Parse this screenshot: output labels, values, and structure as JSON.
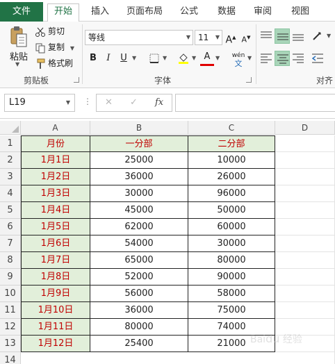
{
  "ribbon_tabs": [
    "文件",
    "开始",
    "插入",
    "页面布局",
    "公式",
    "数据",
    "审阅",
    "视图"
  ],
  "clipboard": {
    "paste": "粘贴",
    "cut": "剪切",
    "copy": "复制",
    "format_painter": "格式刷",
    "group_label": "剪贴板"
  },
  "font": {
    "name": "等线",
    "size": "11",
    "grow": "A",
    "shrink": "A",
    "bold": "B",
    "italic": "I",
    "underline": "U",
    "phonetic": "wén",
    "group_label": "字体"
  },
  "alignment": {
    "group_label": "对齐"
  },
  "formula_bar": {
    "name_box": "L19",
    "more": "⋮",
    "cancel": "✕",
    "enter": "✓",
    "fx": "fx",
    "value": ""
  },
  "columns": [
    "A",
    "B",
    "C",
    "D"
  ],
  "rows": [
    "1",
    "2",
    "3",
    "4",
    "5",
    "6",
    "7",
    "8",
    "9",
    "10",
    "11",
    "12",
    "13",
    "14"
  ],
  "table": {
    "headers": [
      "月份",
      "一分部",
      "二分部"
    ],
    "data": [
      [
        "1月1日",
        "25000",
        "10000"
      ],
      [
        "1月2日",
        "36000",
        "26000"
      ],
      [
        "1月3日",
        "30000",
        "96000"
      ],
      [
        "1月4日",
        "45000",
        "50000"
      ],
      [
        "1月5日",
        "62000",
        "60000"
      ],
      [
        "1月6日",
        "54000",
        "30000"
      ],
      [
        "1月7日",
        "65000",
        "80000"
      ],
      [
        "1月8日",
        "52000",
        "90000"
      ],
      [
        "1月9日",
        "56000",
        "58000"
      ],
      [
        "1月10日",
        "36000",
        "75000"
      ],
      [
        "1月11日",
        "80000",
        "74000"
      ],
      [
        "1月12日",
        "25400",
        "21000"
      ]
    ]
  },
  "colors": {
    "accent": "#217346",
    "header_fill": "#e2efda",
    "header_text": "#c00000"
  }
}
